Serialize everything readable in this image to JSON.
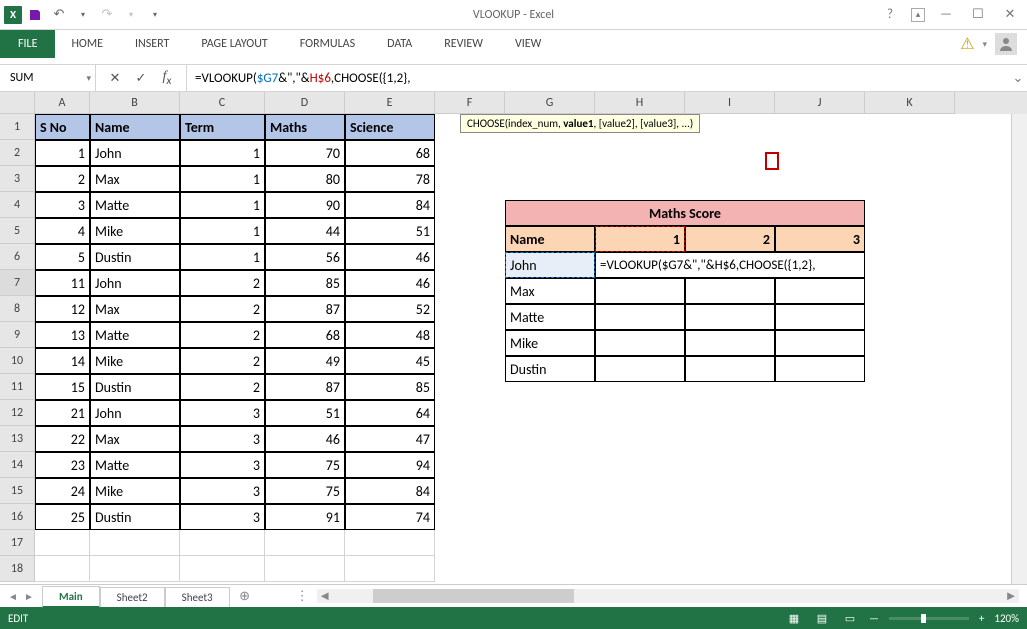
{
  "app": {
    "title": "VLOOKUP - Excel",
    "name_box": "SUM",
    "formula_plain": "=VLOOKUP(",
    "formula_ref1": "$G7",
    "formula_mid1": "&\",\"&",
    "formula_ref2": "H$6",
    "formula_mid2": ",CHOOSE({1,2},",
    "tooltip_prefix": "CHOOSE(index_num, ",
    "tooltip_bold": "value1",
    "tooltip_suffix": ", [value2], [value3], ...)",
    "status_mode": "EDIT",
    "zoom": "120%",
    "active_sheet": "Main"
  },
  "ribbon": {
    "file": "FILE",
    "tabs": [
      "HOME",
      "INSERT",
      "PAGE LAYOUT",
      "FORMULAS",
      "DATA",
      "REVIEW",
      "VIEW"
    ]
  },
  "sheets": [
    "Main",
    "Sheet2",
    "Sheet3"
  ],
  "columns": [
    "A",
    "B",
    "C",
    "D",
    "E",
    "F",
    "G",
    "H",
    "I",
    "J",
    "K"
  ],
  "row_numbers": [
    1,
    2,
    3,
    4,
    5,
    6,
    7,
    8,
    9,
    10,
    11,
    12,
    13,
    14,
    15,
    16,
    17,
    18
  ],
  "main_table": {
    "headers": [
      "S No",
      "Name",
      "Term",
      "Maths",
      "Science"
    ],
    "rows": [
      {
        "sno": 1,
        "name": "John",
        "term": 1,
        "maths": 70,
        "sci": 68
      },
      {
        "sno": 2,
        "name": "Max",
        "term": 1,
        "maths": 80,
        "sci": 78
      },
      {
        "sno": 3,
        "name": "Matte",
        "term": 1,
        "maths": 90,
        "sci": 84
      },
      {
        "sno": 4,
        "name": "Mike",
        "term": 1,
        "maths": 44,
        "sci": 51
      },
      {
        "sno": 5,
        "name": "Dustin",
        "term": 1,
        "maths": 56,
        "sci": 46
      },
      {
        "sno": 11,
        "name": "John",
        "term": 2,
        "maths": 85,
        "sci": 46
      },
      {
        "sno": 12,
        "name": "Max",
        "term": 2,
        "maths": 87,
        "sci": 52
      },
      {
        "sno": 13,
        "name": "Matte",
        "term": 2,
        "maths": 68,
        "sci": 48
      },
      {
        "sno": 14,
        "name": "Mike",
        "term": 2,
        "maths": 49,
        "sci": 45
      },
      {
        "sno": 15,
        "name": "Dustin",
        "term": 2,
        "maths": 87,
        "sci": 85
      },
      {
        "sno": 21,
        "name": "John",
        "term": 3,
        "maths": 51,
        "sci": 64
      },
      {
        "sno": 22,
        "name": "Max",
        "term": 3,
        "maths": 46,
        "sci": 47
      },
      {
        "sno": 23,
        "name": "Matte",
        "term": 3,
        "maths": 75,
        "sci": 94
      },
      {
        "sno": 24,
        "name": "Mike",
        "term": 3,
        "maths": 75,
        "sci": 84
      },
      {
        "sno": 25,
        "name": "Dustin",
        "term": 3,
        "maths": 91,
        "sci": 74
      }
    ]
  },
  "lookup_box": {
    "title": "Maths Score",
    "name_header": "Name",
    "cols": [
      1,
      2,
      3
    ],
    "names": [
      "John",
      "Max",
      "Matte",
      "Mike",
      "Dustin"
    ],
    "editing_formula": "=VLOOKUP($G7&\",\"&H$6,CHOOSE({1,2},"
  }
}
